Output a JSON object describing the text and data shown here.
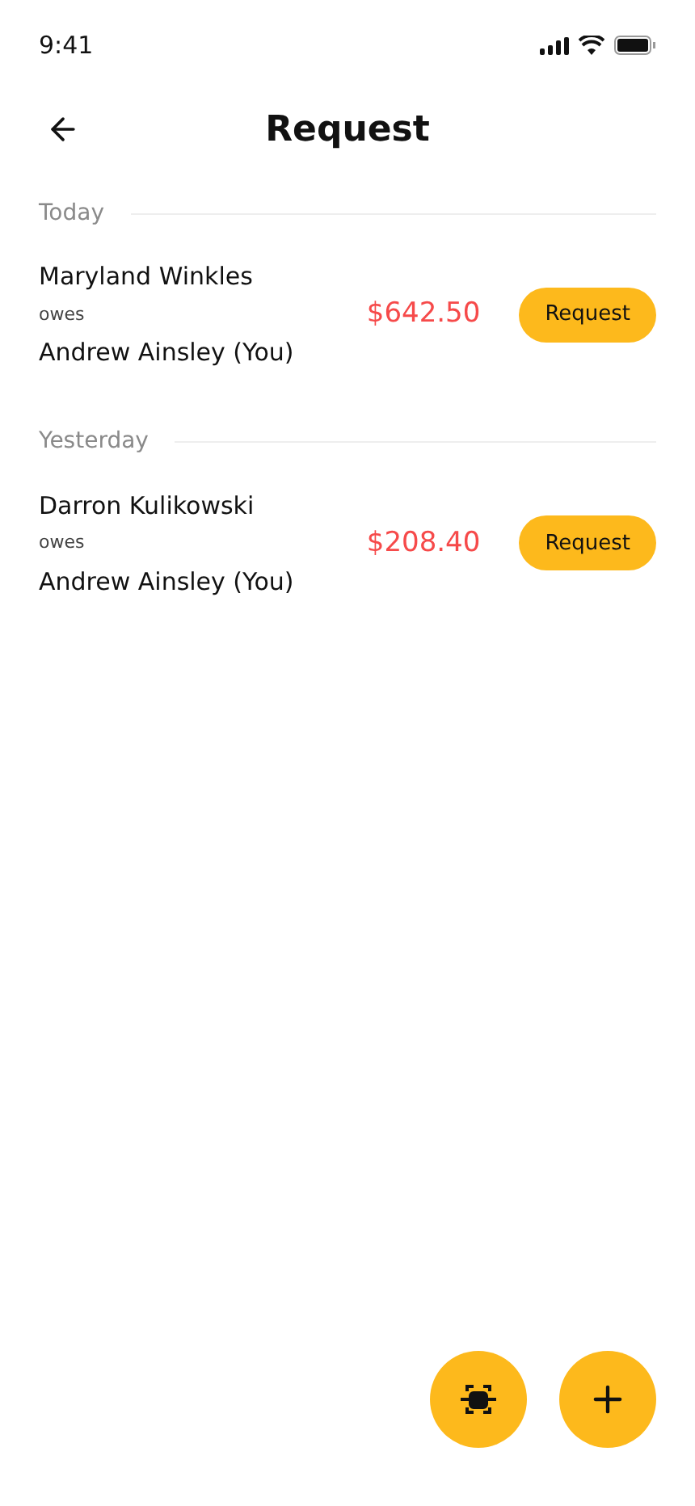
{
  "status_bar": {
    "time": "9:41"
  },
  "header": {
    "title": "Request"
  },
  "groups": [
    {
      "label": "Today",
      "items": [
        {
          "payer": "Maryland Winkles",
          "verb": "owes",
          "payee": "Andrew Ainsley (You)",
          "amount": "$642.50",
          "action": "Request"
        }
      ]
    },
    {
      "label": "Yesterday",
      "items": [
        {
          "payer": "Darron Kulikowski",
          "verb": "owes",
          "payee": "Andrew Ainsley (You)",
          "amount": "$208.40",
          "action": "Request"
        }
      ]
    }
  ]
}
